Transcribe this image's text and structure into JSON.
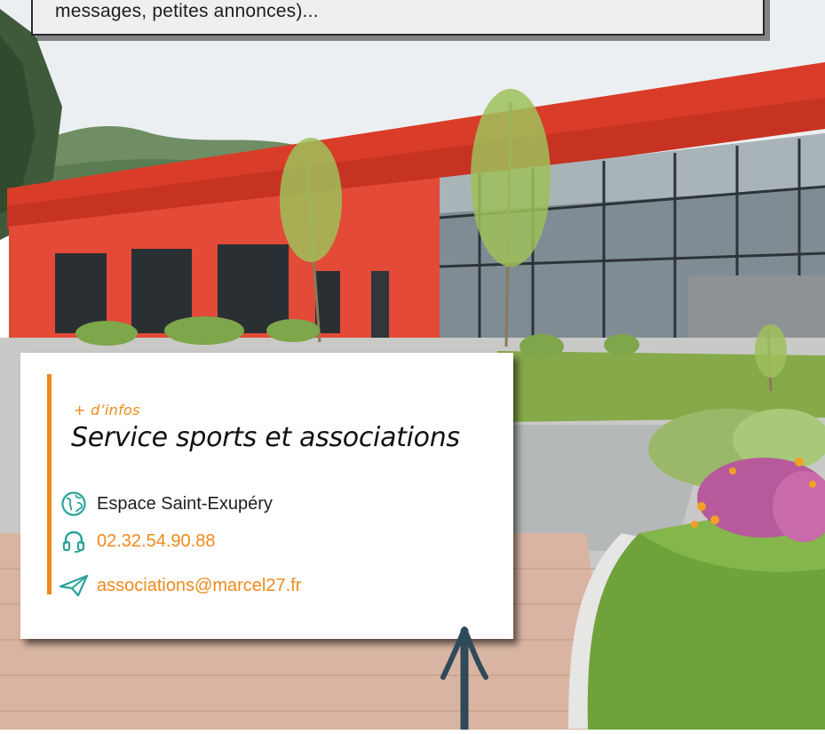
{
  "intro": {
    "text": "messages, petites annonces)..."
  },
  "info_card": {
    "kicker": "+ d’infos",
    "title": "Service sports et associations",
    "location": {
      "icon": "globe-icon",
      "text": "Espace Saint-Exupéry"
    },
    "phone": {
      "icon": "headset-icon",
      "text": "02.32.54.90.88"
    },
    "email": {
      "icon": "paper-plane-icon",
      "text": "associations@marcel27.fr"
    }
  },
  "colors": {
    "accent": "#ee8a1c",
    "icon": "#2aa39a",
    "building_red": "#e34a37",
    "arrow": "#2e4a5b"
  },
  "photo": {
    "subject": "sports-hall-building-icon"
  }
}
